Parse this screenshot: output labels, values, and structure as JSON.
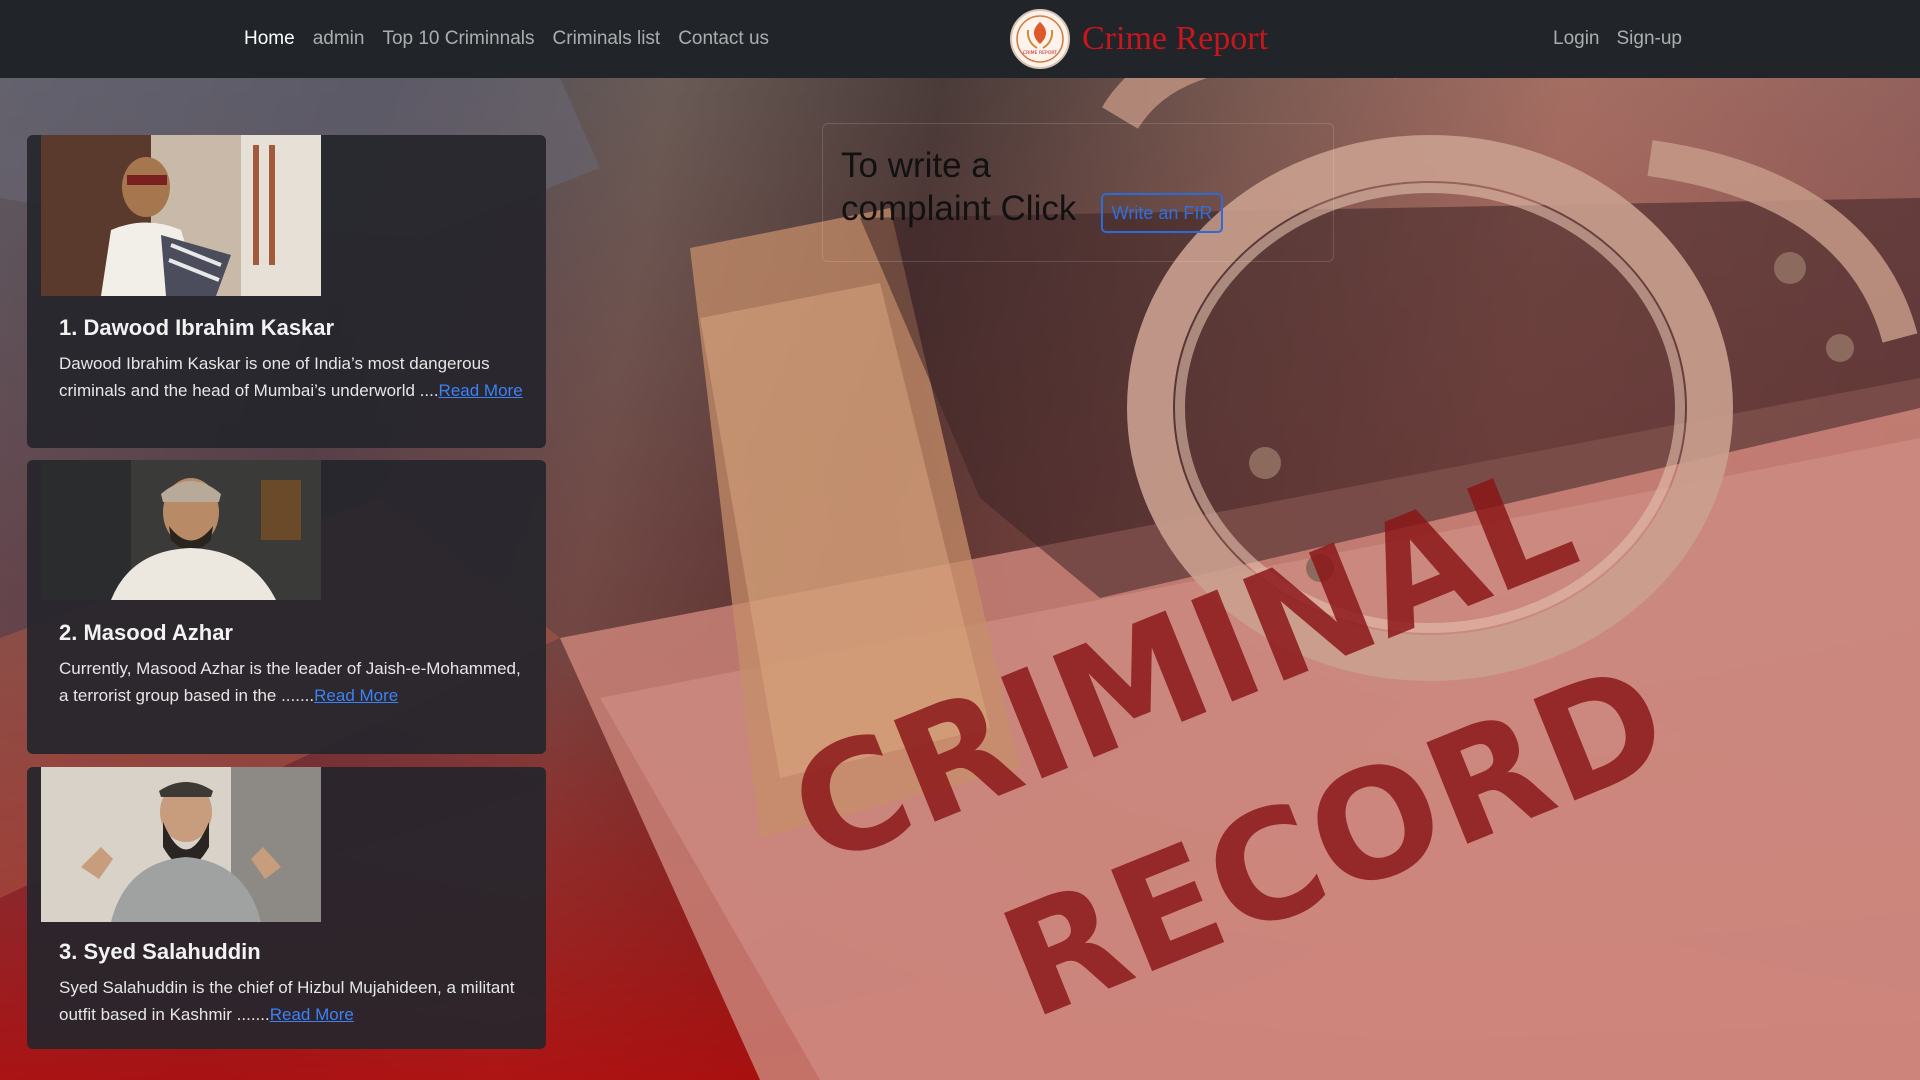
{
  "nav": {
    "links": [
      "Home",
      "admin",
      "Top 10 Criminnals",
      "Criminals list",
      "Contact us"
    ],
    "brand": "Crime Report",
    "logo_text": "CRIME REPORT",
    "auth": [
      "Login",
      "Sign-up"
    ]
  },
  "background_text": {
    "line1": "CRIMINAL",
    "line2": "RECORD"
  },
  "cards": [
    {
      "title": "1. Dawood Ibrahim Kaskar",
      "text": "Dawood Ibrahim Kaskar is one of India’s most dangerous criminals and the head of Mumbai’s underworld ....",
      "link": "Read More"
    },
    {
      "title": "2. Masood Azhar",
      "text": "Currently, Masood Azhar is the leader of Jaish-e-Mohammed, a terrorist group based in the .......",
      "link": "Read More"
    },
    {
      "title": "3. Syed Salahuddin",
      "text": "Syed Salahuddin is the chief of Hizbul Mujahideen, a militant outfit based in Kashmir .......",
      "link": "Read More"
    }
  ],
  "complaint": {
    "text": "To write a complaint Click",
    "button": "Write an FIR"
  },
  "colors": {
    "navbar": "#212529",
    "brand": "#c8161d",
    "link": "#3b82f6",
    "card": "#26262c"
  }
}
